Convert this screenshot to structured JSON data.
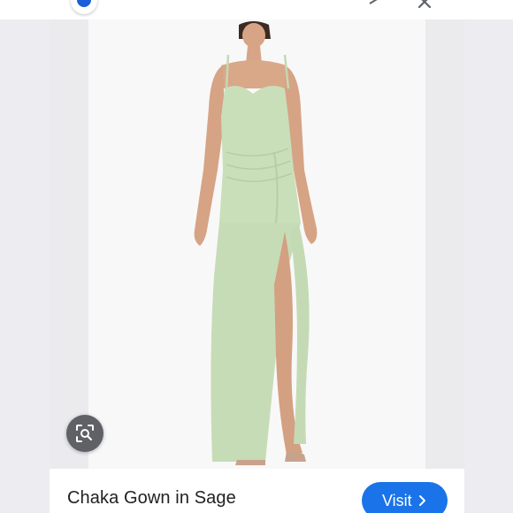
{
  "product": {
    "title": "Chaka Gown in Sage",
    "image_alt": "Sage green strapless-style gown with slit"
  },
  "actions": {
    "visit_label": "Visit"
  },
  "icons": {
    "lens": "google-lens-icon",
    "share": "share-icon",
    "close": "close-icon",
    "visual_search": "visual-search-icon",
    "chevron": "chevron-right-icon"
  },
  "colors": {
    "accent": "#1a73e8",
    "gown": "#c9dfba",
    "lens_button": "#5f6166"
  }
}
